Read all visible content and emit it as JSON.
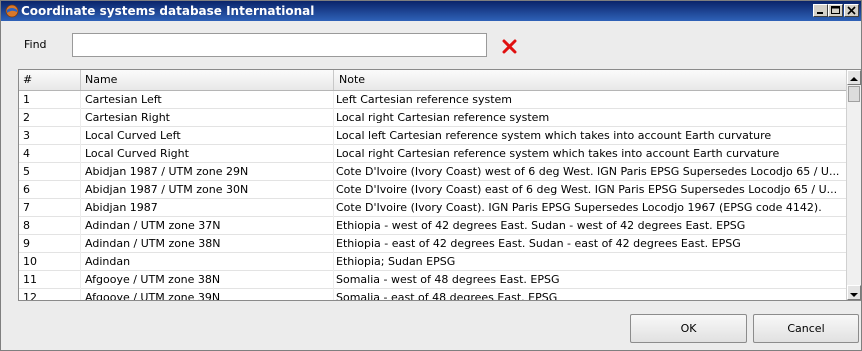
{
  "window": {
    "title": "Coordinate systems database International",
    "accent": "#0a246a"
  },
  "find": {
    "label": "Find",
    "value": "",
    "placeholder": ""
  },
  "table": {
    "columns": [
      "#",
      "Name",
      "Note"
    ],
    "rows": [
      {
        "num": "1",
        "name": "Cartesian Left",
        "note": "Left Cartesian reference system"
      },
      {
        "num": "2",
        "name": "Cartesian Right",
        "note": "Local right Cartesian reference system"
      },
      {
        "num": "3",
        "name": "Local Curved Left",
        "note": "Local left Cartesian reference system which takes into account Earth curvature"
      },
      {
        "num": "4",
        "name": "Local Curved Right",
        "note": "Local right Cartesian reference system which takes into account Earth curvature"
      },
      {
        "num": "5",
        "name": "Abidjan 1987 / UTM zone 29N",
        "note": "Cote D'Ivoire (Ivory Coast) west of 6 deg West. IGN Paris EPSG Supersedes Locodjo 65 / U..."
      },
      {
        "num": "6",
        "name": "Abidjan 1987 / UTM zone 30N",
        "note": "Cote D'Ivoire (Ivory Coast) east of 6 deg West. IGN Paris EPSG Supersedes Locodjo 65 / U..."
      },
      {
        "num": "7",
        "name": "Abidjan 1987",
        "note": "Cote D'Ivoire (Ivory Coast). IGN Paris EPSG Supersedes Locodjo 1967 (EPSG code 4142)."
      },
      {
        "num": "8",
        "name": "Adindan / UTM zone 37N",
        "note": "Ethiopia - west of 42 degrees East.  Sudan - west of 42 degrees East. EPSG"
      },
      {
        "num": "9",
        "name": "Adindan / UTM zone 38N",
        "note": "Ethiopia - east of 42 degrees East.  Sudan - east of 42 degrees East. EPSG"
      },
      {
        "num": "10",
        "name": "Adindan",
        "note": "Ethiopia; Sudan EPSG"
      },
      {
        "num": "11",
        "name": "Afgooye / UTM zone 38N",
        "note": "Somalia - west of 48 degrees East. EPSG"
      },
      {
        "num": "12",
        "name": "Afgooye / UTM zone 39N",
        "note": "Somalia - east of 48 degrees East. EPSG"
      }
    ]
  },
  "buttons": {
    "ok": "OK",
    "cancel": "Cancel"
  },
  "icons": {
    "app": "globe-icon",
    "clear": "clear-x-icon"
  }
}
